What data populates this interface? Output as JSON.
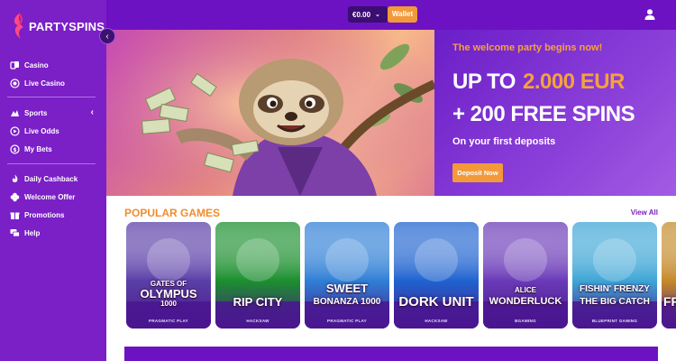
{
  "brand": {
    "name": "PARTYSPINS"
  },
  "topbar": {
    "balance": "€0.00",
    "wallet_label": "Wallet"
  },
  "sidebar": {
    "group1": [
      {
        "label": "Casino",
        "icon": "cards-icon"
      },
      {
        "label": "Live Casino",
        "icon": "live-casino-icon"
      }
    ],
    "group2": [
      {
        "label": "Sports",
        "icon": "sports-icon"
      },
      {
        "label": "Live Odds",
        "icon": "play-icon"
      },
      {
        "label": "My Bets",
        "icon": "coin-icon"
      }
    ],
    "group3": [
      {
        "label": "Daily Cashback",
        "icon": "flame-icon"
      },
      {
        "label": "Welcome Offer",
        "icon": "clover-icon"
      },
      {
        "label": "Promotions",
        "icon": "gift-icon"
      },
      {
        "label": "Help",
        "icon": "chat-icon"
      }
    ]
  },
  "hero": {
    "kicker": "The welcome party begins now!",
    "line1_prefix": "UP TO",
    "line1_amount": "2.000 EUR",
    "line2": "+ 200 FREE SPINS",
    "subtitle": "On your first deposits",
    "cta": "Deposit Now"
  },
  "games_section": {
    "title": "POPULAR GAMES",
    "view_all": "View All",
    "games": [
      {
        "small": "GATES OF",
        "name": "OLYMPUS",
        "extra": "1000",
        "provider": "PRAGMATIC PLAY",
        "color": "#5a3fa8"
      },
      {
        "small": "",
        "name": "RIP CITY",
        "extra": "",
        "provider": "HACKSAW",
        "color": "#1b8f2e"
      },
      {
        "small": "SWEET",
        "name": "BONANZA 1000",
        "extra": "",
        "provider": "PRAGMATIC PLAY",
        "color": "#2f7fd6"
      },
      {
        "small": "",
        "name": "DORK UNIT",
        "extra": "",
        "provider": "HACKSAW",
        "color": "#1f63d0"
      },
      {
        "small": "ALICE",
        "name": "WONDERLUCK",
        "extra": "",
        "provider": "BGAMING",
        "color": "#6a3ab8"
      },
      {
        "small": "FISHIN' FRENZY",
        "name": "THE BIG CATCH",
        "extra": "",
        "provider": "BLUEPRINT GAMING",
        "color": "#3ea6d6"
      },
      {
        "small": "",
        "name": "FR",
        "extra": "",
        "provider": "",
        "color": "#c58a2a"
      }
    ]
  },
  "colors": {
    "brand_purple": "#7b1fc7",
    "accent_orange": "#f2993a",
    "topbar": "#6d12c2"
  }
}
